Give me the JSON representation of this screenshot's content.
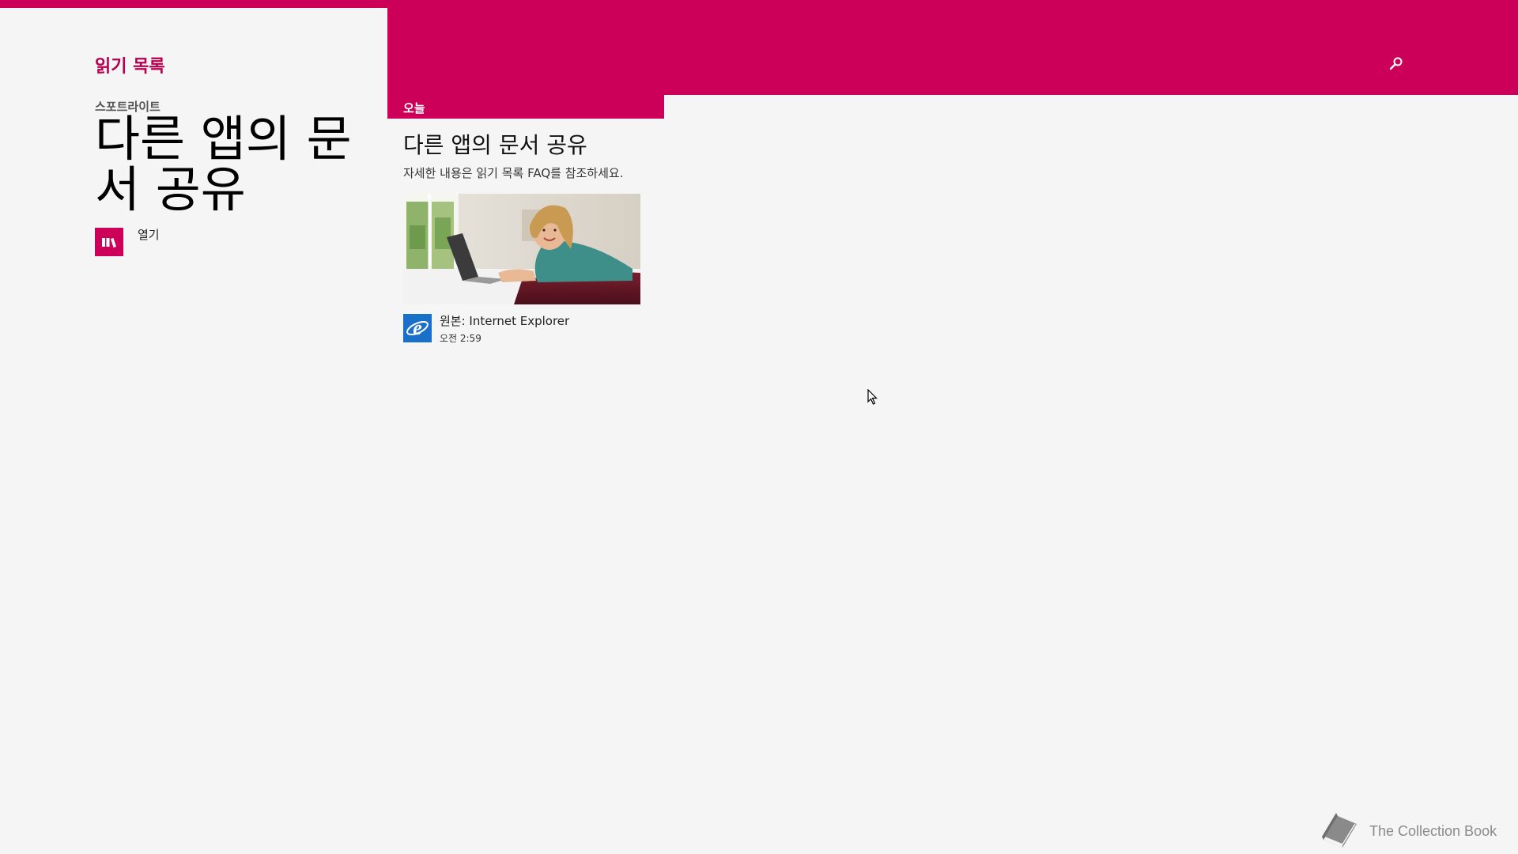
{
  "app": {
    "title": "읽기 목록"
  },
  "header": {
    "search_icon": "search-icon",
    "accent_color": "#cc0058"
  },
  "spotlight": {
    "section_label": "스포트라이트",
    "title": "다른 앱의 문서 공유",
    "open_label": "열기",
    "open_icon": "reading-list-icon"
  },
  "today": {
    "section_label": "오늘",
    "article": {
      "title": "다른 앱의 문서 공유",
      "description": "자세한 내용은 읽기 목록 FAQ를 참조하세요.",
      "thumbnail": "woman-with-laptop-photo",
      "source": "원본: Internet Explorer",
      "source_icon": "internet-explorer-icon",
      "time": "오전 2:59"
    }
  },
  "watermark": {
    "text": "The Collection Book",
    "icon": "book-icon"
  }
}
